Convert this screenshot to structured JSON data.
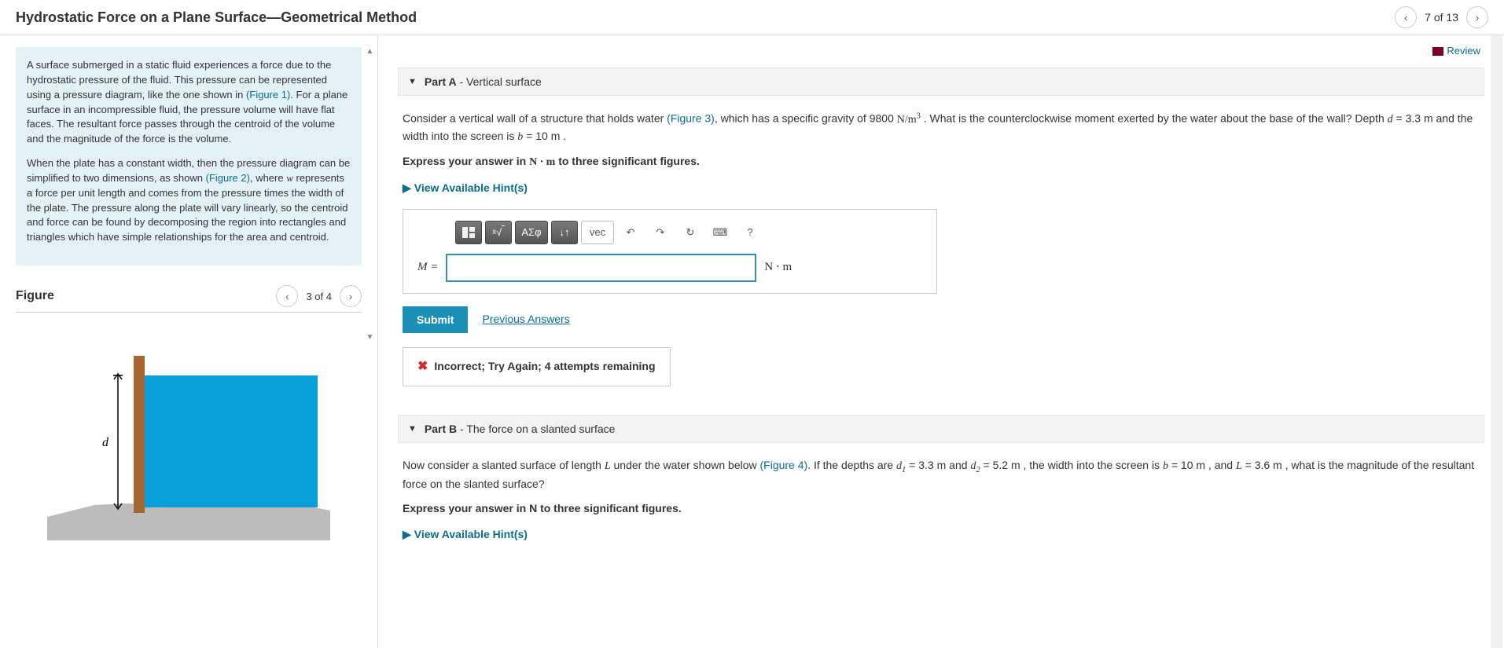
{
  "header": {
    "title": "Hydrostatic Force on a Plane Surface—Geometrical Method",
    "page_counter": "7 of 13"
  },
  "intro": {
    "p1_a": "A surface submerged in a static fluid experiences a force due to the hydrostatic pressure of the fluid. This pressure can be represented using a pressure diagram, like the one shown in ",
    "fig1": "(Figure 1)",
    "p1_b": ". For a plane surface in an incompressible fluid, the pressure volume will have flat faces. The resultant force passes through the centroid of the volume and the magnitude of the force is the volume.",
    "p2_a": "When the plate has a constant width, then the pressure diagram can be simplified to two dimensions, as shown ",
    "fig2": "(Figure 2)",
    "p2_b": ", where ",
    "w": "w",
    "p2_c": " represents a force per unit length and comes from the pressure times the width of the plate. The pressure along the plate will vary linearly, so the centroid and force can be found by decomposing the region into rectangles and triangles which have simple relationships for the area and centroid."
  },
  "figure": {
    "heading": "Figure",
    "counter": "3 of 4",
    "d_label": "d"
  },
  "review": "Review",
  "partA": {
    "label": "Part A",
    "subtitle": " - Vertical surface",
    "q1a": "Consider a vertical wall of a structure that holds water ",
    "fig3": "(Figure 3)",
    "q1b": ", which has a specific gravity of 9800 ",
    "unit1": "N/m",
    "unit1sup": "3",
    "q1c": " . What is the counterclockwise moment exerted by the water about the base of the wall? Depth ",
    "dvar": "d",
    "q1d": " = 3.3  m and the width into the screen is ",
    "bvar": "b",
    "q1e": " = 10  m .",
    "express_a": "Express your answer in ",
    "express_unit": "N ⋅ m",
    "express_b": " to three significant figures.",
    "hints": "View Available Hint(s)",
    "var_label": "M =",
    "out_unit": "N ⋅ m",
    "submit": "Submit",
    "prev": "Previous Answers",
    "feedback": "Incorrect; Try Again; 4 attempts remaining",
    "toolbar": {
      "templates": " ",
      "root": "√",
      "greek": "ΑΣφ",
      "arrows": "↓↑",
      "vec": "vec",
      "undo": "↶",
      "redo": "↷",
      "reset": "↻",
      "keyboard": "⌨",
      "help": "?"
    }
  },
  "partB": {
    "label": "Part B",
    "subtitle": " - The force on a slanted surface",
    "q1a": "Now consider a slanted surface of length ",
    "Lvar": "L",
    "q1b": " under the water shown below ",
    "fig4": "(Figure 4)",
    "q1c": ". If the depths are ",
    "d1var": "d",
    "d1sub": "1",
    "q1d": " = 3.3  m and ",
    "d2var": "d",
    "d2sub": "2",
    "q1e": " = 5.2  m , the width into the screen is ",
    "bvar": "b",
    "q1f": " = 10  m , and ",
    "q1g": " = 3.6  m , what is the magnitude of the resultant force on the slanted surface?",
    "express": "Express your answer in N to three significant figures.",
    "hints": "View Available Hint(s)"
  }
}
